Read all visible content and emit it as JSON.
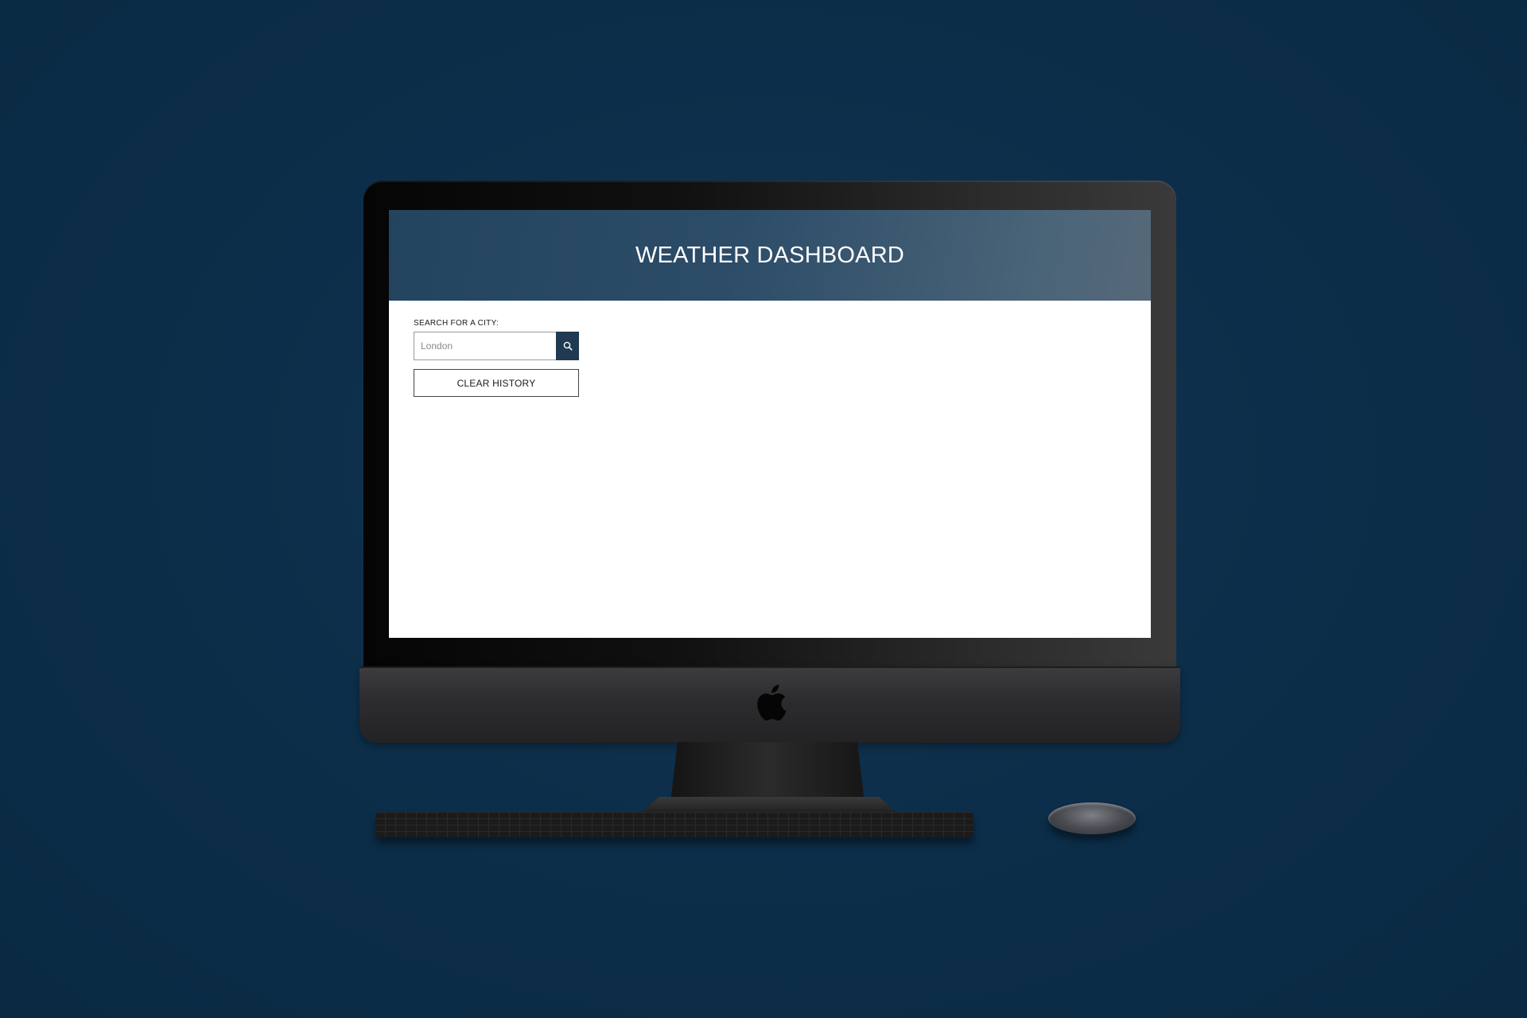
{
  "app": {
    "title": "WEATHER DASHBOARD"
  },
  "search": {
    "label": "SEARCH FOR A CITY:",
    "placeholder": "London",
    "value": "",
    "button_icon": "search-icon"
  },
  "history": {
    "clear_label": "CLEAR HISTORY"
  },
  "colors": {
    "background": "#0c2d48",
    "header_start": "#23445f",
    "header_end": "#56697a",
    "search_button": "#1f3a52"
  }
}
